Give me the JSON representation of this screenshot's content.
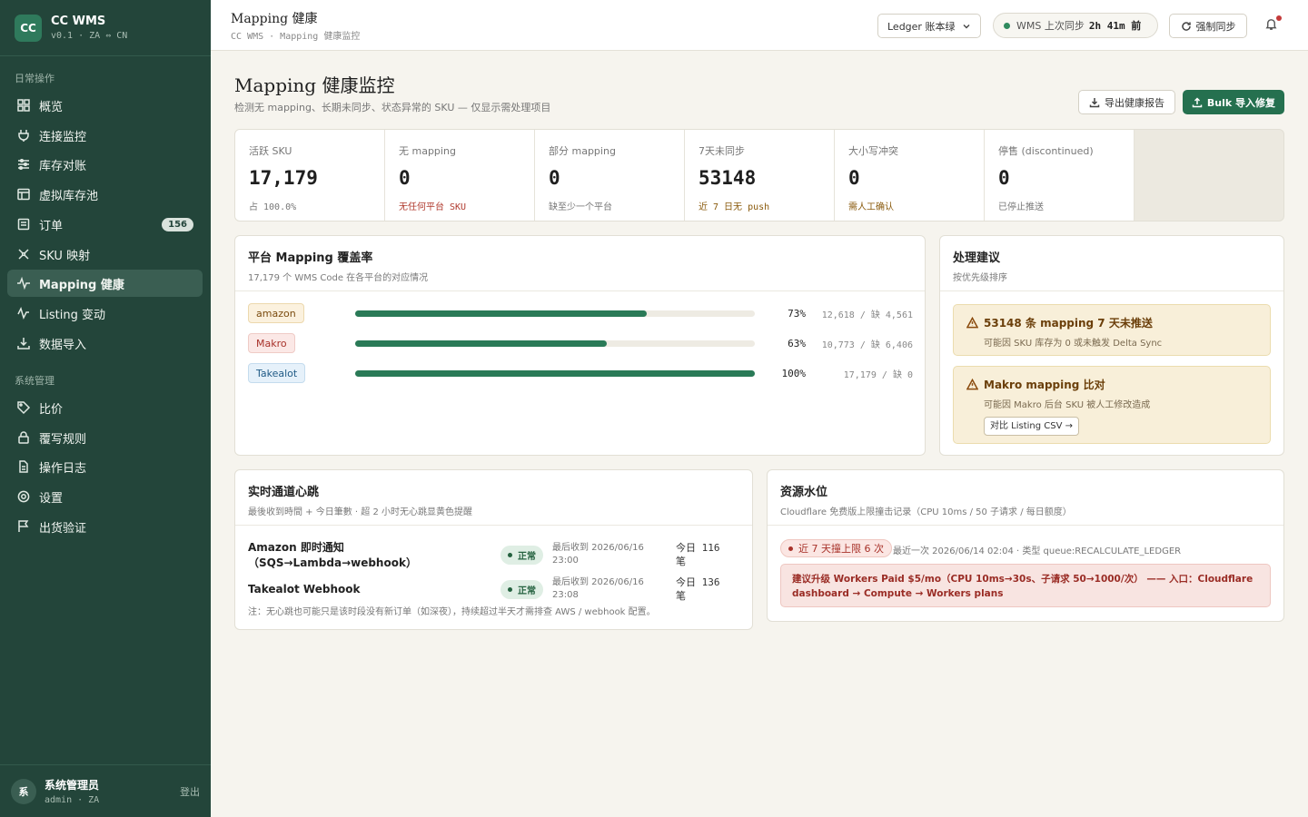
{
  "brand": {
    "logo": "CC",
    "title": "CC WMS",
    "subtitle": "v0.1 · ZA ⇔ CN"
  },
  "sidebar": {
    "section_daily": "日常操作",
    "section_system": "系统管理",
    "items": [
      {
        "label": "概览",
        "icon": "grid-icon"
      },
      {
        "label": "连接监控",
        "icon": "plug-icon"
      },
      {
        "label": "库存对账",
        "icon": "sliders-icon"
      },
      {
        "label": "虚拟库存池",
        "icon": "layout-icon"
      },
      {
        "label": "订单",
        "icon": "receipt-icon",
        "badge": "156"
      },
      {
        "label": "SKU 映射",
        "icon": "route-icon"
      },
      {
        "label": "Mapping 健康",
        "icon": "pulse-icon",
        "active": true
      },
      {
        "label": "Listing 变动",
        "icon": "activity-icon"
      },
      {
        "label": "数据导入",
        "icon": "download-icon"
      },
      {
        "label": "比价",
        "icon": "tag-icon"
      },
      {
        "label": "覆写规则",
        "icon": "lock-icon"
      },
      {
        "label": "操作日志",
        "icon": "file-icon"
      },
      {
        "label": "设置",
        "icon": "gear-icon"
      },
      {
        "label": "出货验证",
        "icon": "flag-icon"
      }
    ]
  },
  "user": {
    "avatar": "系",
    "name": "系统管理员",
    "sub": "admin · ZA",
    "logout": "登出"
  },
  "topbar": {
    "title": "Mapping 健康",
    "breadcrumb": "CC WMS · Mapping 健康监控",
    "ledger_select": "Ledger 账本绿",
    "sync_label": "WMS 上次同步",
    "sync_value": "2h 41m 前",
    "force_sync": "强制同步"
  },
  "page": {
    "title": "Mapping 健康监控",
    "subtitle": "检测无 mapping、长期未同步、状态异常的 SKU — 仅显示需处理项目",
    "export_button": "导出健康报告",
    "bulk_button": "Bulk 导入修复"
  },
  "stats": [
    {
      "label": "活跃 SKU",
      "value": "17,179",
      "note": "占 100.0%",
      "color": "#777777"
    },
    {
      "label": "无 mapping",
      "value": "0",
      "note": "无任何平台 SKU",
      "color": "#b03a2e"
    },
    {
      "label": "部分 mapping",
      "value": "0",
      "note": "缺至少一个平台",
      "color": "#777777"
    },
    {
      "label": "7天未同步",
      "value": "53148",
      "note": "近 7 日无 push",
      "color": "#8a5a0c"
    },
    {
      "label": "大小写冲突",
      "value": "0",
      "note": "需人工确认",
      "color": "#8a5a0c"
    },
    {
      "label": "停售 (discontinued)",
      "value": "0",
      "note": "已停止推送",
      "color": "#777777"
    }
  ],
  "coverage": {
    "title": "平台 Mapping 覆盖率",
    "subtitle": "17,179 个 WMS Code 在各平台的对应情况",
    "rows": [
      {
        "platform": "amazon",
        "percent": 73,
        "percent_label": "73%",
        "detail": "12,618 / 缺 4,561",
        "chip_bg": "#fbf1de",
        "chip_border": "#ecd8ad",
        "chip_color": "#7a4b0f"
      },
      {
        "platform": "Makro",
        "percent": 63,
        "percent_label": "63%",
        "detail": "10,773 / 缺 6,406",
        "chip_bg": "#fbe8e6",
        "chip_border": "#efcbc6",
        "chip_color": "#a8322a"
      },
      {
        "platform": "Takealot",
        "percent": 100,
        "percent_label": "100%",
        "detail": "17,179 / 缺 0",
        "chip_bg": "#e6f1fa",
        "chip_border": "#c4dcee",
        "chip_color": "#1f5a85"
      }
    ]
  },
  "advice": {
    "title": "处理建议",
    "subtitle": "按优先级排序",
    "items": [
      {
        "title": "53148 条 mapping 7 天未推送",
        "desc": "可能因 SKU 库存为 0 或未触发 Delta Sync"
      },
      {
        "title": "Makro mapping 比对",
        "desc": "可能因 Makro 后台 SKU 被人工修改造成",
        "button": "对比 Listing CSV →"
      }
    ]
  },
  "heartbeat": {
    "title": "实时通道心跳",
    "subtitle": "最後收到時間 + 今日筆數 · 超 2 小时无心跳显黄色提醒",
    "rows": [
      {
        "name": "Amazon 即时通知（SQS→Lambda→webhook）",
        "status": "正常",
        "last": "最后收到 2026/06/16 23:00",
        "today": "今日 116 笔"
      },
      {
        "name": "Takealot Webhook",
        "status": "正常",
        "last": "最后收到 2026/06/16 23:08",
        "today": "今日 136 笔"
      }
    ],
    "note": "注：无心跳也可能只是该时段没有新订单（如深夜），持续超过半天才需排查 AWS / webhook 配置。"
  },
  "resources": {
    "title": "资源水位",
    "subtitle": "Cloudflare 免费版上限撞击记录（CPU 10ms / 50 子请求 / 每日额度）",
    "pill": "近 7 天撞上限 6 次",
    "last": "最近一次 2026/06/14 02:04 · 类型 queue:RECALCULATE_LEDGER",
    "advice": "建议升级 Workers Paid $5/mo（CPU 10ms→30s、子请求 50→1000/次） —— 入口：Cloudflare dashboard → Compute → Workers plans"
  }
}
